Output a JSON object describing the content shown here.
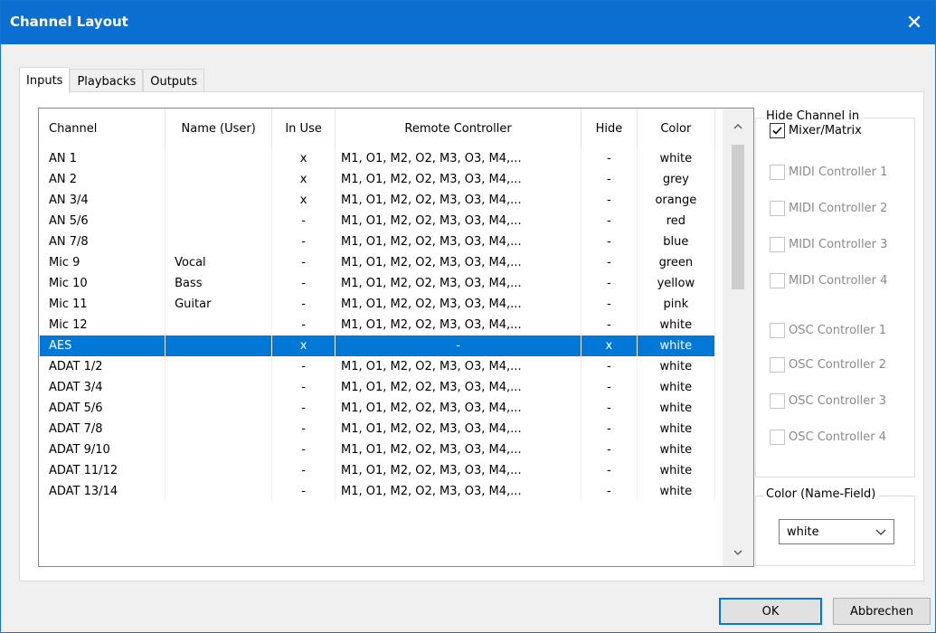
{
  "window": {
    "title": "Channel Layout",
    "close_glyph": "✕"
  },
  "tabs": [
    {
      "label": "Inputs"
    },
    {
      "label": "Playbacks"
    },
    {
      "label": "Outputs"
    }
  ],
  "table": {
    "headers": [
      "Channel",
      "Name (User)",
      "In Use",
      "Remote Controller",
      "Hide",
      "Color"
    ],
    "rows": [
      {
        "channel": "AN 1",
        "name": "",
        "inuse": "x",
        "remote": "M1, O1, M2, O2, M3, O3, M4,...",
        "hide": "-",
        "color": "white"
      },
      {
        "channel": "AN 2",
        "name": "",
        "inuse": "x",
        "remote": "M1, O1, M2, O2, M3, O3, M4,...",
        "hide": "-",
        "color": "grey"
      },
      {
        "channel": "AN 3/4",
        "name": "",
        "inuse": "x",
        "remote": "M1, O1, M2, O2, M3, O3, M4,...",
        "hide": "-",
        "color": "orange"
      },
      {
        "channel": "AN 5/6",
        "name": "",
        "inuse": "-",
        "remote": "M1, O1, M2, O2, M3, O3, M4,...",
        "hide": "-",
        "color": "red"
      },
      {
        "channel": "AN 7/8",
        "name": "",
        "inuse": "-",
        "remote": "M1, O1, M2, O2, M3, O3, M4,...",
        "hide": "-",
        "color": "blue"
      },
      {
        "channel": "Mic 9",
        "name": "Vocal",
        "inuse": "-",
        "remote": "M1, O1, M2, O2, M3, O3, M4,...",
        "hide": "-",
        "color": "green"
      },
      {
        "channel": "Mic 10",
        "name": "Bass",
        "inuse": "-",
        "remote": "M1, O1, M2, O2, M3, O3, M4,...",
        "hide": "-",
        "color": "yellow"
      },
      {
        "channel": "Mic 11",
        "name": "Guitar",
        "inuse": "-",
        "remote": "M1, O1, M2, O2, M3, O3, M4,...",
        "hide": "-",
        "color": "pink"
      },
      {
        "channel": "Mic 12",
        "name": "",
        "inuse": "-",
        "remote": "M1, O1, M2, O2, M3, O3, M4,...",
        "hide": "-",
        "color": "white"
      },
      {
        "channel": "AES",
        "name": "",
        "inuse": "x",
        "remote": "-",
        "hide": "x",
        "color": "white"
      },
      {
        "channel": "ADAT 1/2",
        "name": "",
        "inuse": "-",
        "remote": "M1, O1, M2, O2, M3, O3, M4,...",
        "hide": "-",
        "color": "white"
      },
      {
        "channel": "ADAT 3/4",
        "name": "",
        "inuse": "-",
        "remote": "M1, O1, M2, O2, M3, O3, M4,...",
        "hide": "-",
        "color": "white"
      },
      {
        "channel": "ADAT 5/6",
        "name": "",
        "inuse": "-",
        "remote": "M1, O1, M2, O2, M3, O3, M4,...",
        "hide": "-",
        "color": "white"
      },
      {
        "channel": "ADAT 7/8",
        "name": "",
        "inuse": "-",
        "remote": "M1, O1, M2, O2, M3, O3, M4,...",
        "hide": "-",
        "color": "white"
      },
      {
        "channel": "ADAT 9/10",
        "name": "",
        "inuse": "-",
        "remote": "M1, O1, M2, O2, M3, O3, M4,...",
        "hide": "-",
        "color": "white"
      },
      {
        "channel": "ADAT 11/12",
        "name": "",
        "inuse": "-",
        "remote": "M1, O1, M2, O2, M3, O3, M4,...",
        "hide": "-",
        "color": "white"
      },
      {
        "channel": "ADAT 13/14",
        "name": "",
        "inuse": "-",
        "remote": "M1, O1, M2, O2, M3, O3, M4,...",
        "hide": "-",
        "color": "white"
      }
    ],
    "selected_channel": "AES"
  },
  "hide_group": {
    "legend": "Hide Channel in",
    "items": [
      {
        "label": "Mixer/Matrix",
        "checked": true,
        "enabled": true
      },
      {
        "label": "MIDI Controller 1",
        "checked": false,
        "enabled": false
      },
      {
        "label": "MIDI Controller 2",
        "checked": false,
        "enabled": false
      },
      {
        "label": "MIDI Controller 3",
        "checked": false,
        "enabled": false
      },
      {
        "label": "MIDI Controller 4",
        "checked": false,
        "enabled": false
      },
      {
        "label": "OSC Controller 1",
        "checked": false,
        "enabled": false
      },
      {
        "label": "OSC Controller 2",
        "checked": false,
        "enabled": false
      },
      {
        "label": "OSC Controller 3",
        "checked": false,
        "enabled": false
      },
      {
        "label": "OSC Controller 4",
        "checked": false,
        "enabled": false
      }
    ]
  },
  "color_group": {
    "legend": "Color (Name-Field)",
    "selected": "white"
  },
  "buttons": {
    "ok": "OK",
    "cancel": "Abbrechen"
  },
  "colors": {
    "title_bar": "#0a6fd0",
    "selection": "#0078d7"
  }
}
